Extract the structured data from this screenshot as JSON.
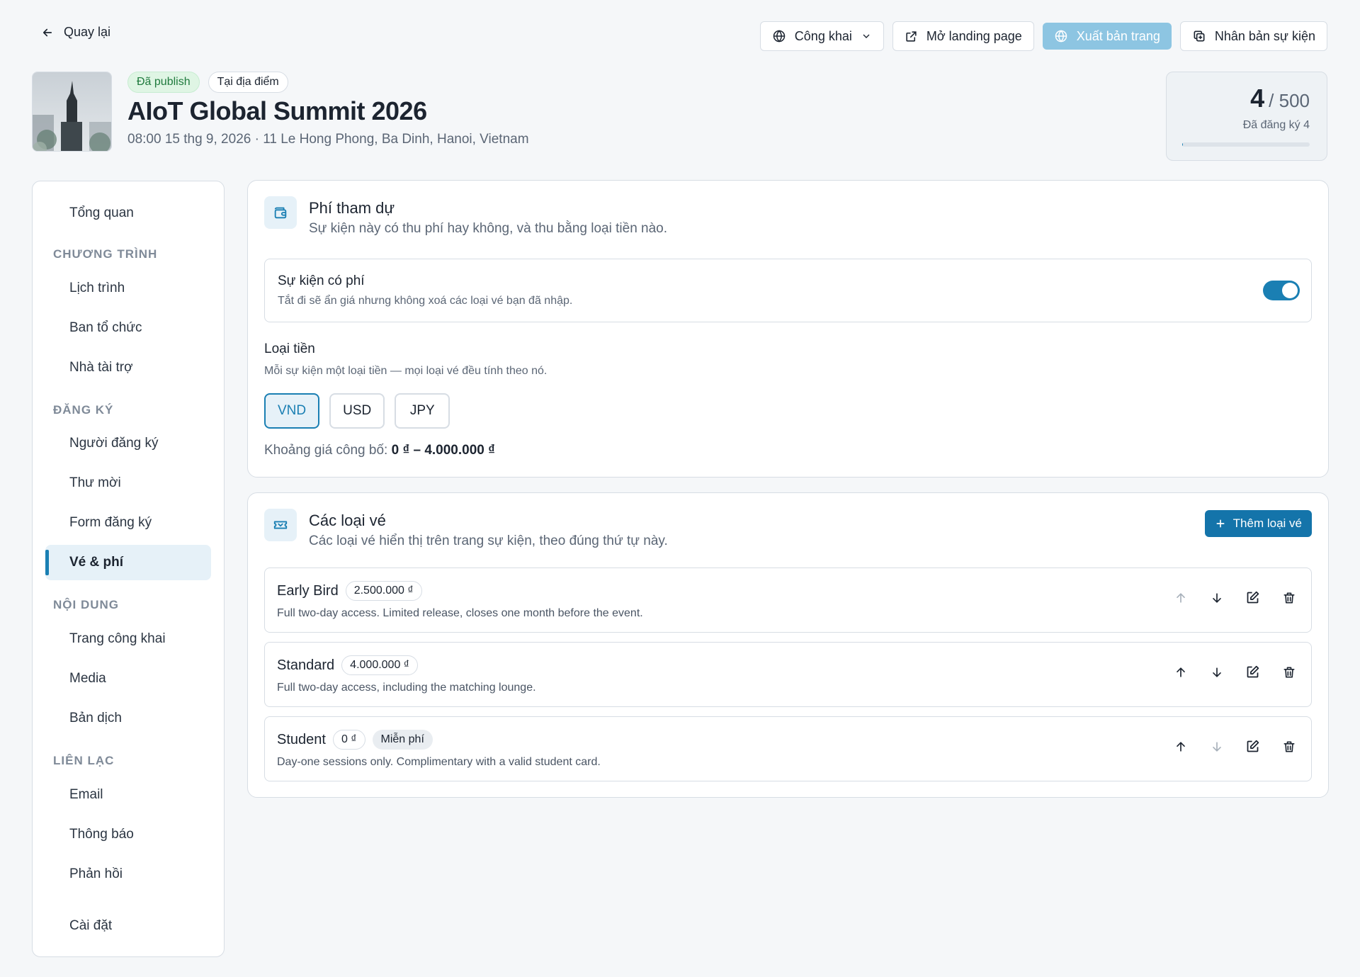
{
  "colors": {
    "accent": "#1a7fb3",
    "accent_light": "#e6f1f8",
    "success": "#1f7a3d",
    "primary_disabled": "#8dc5e2"
  },
  "topbar": {
    "back_label": "Quay lại",
    "visibility_label": "Công khai",
    "open_landing_label": "Mở landing page",
    "publish_label": "Xuất bản trang",
    "duplicate_label": "Nhân bản sự kiện"
  },
  "event": {
    "status_badge": "Đã publish",
    "location_type_badge": "Tại địa điểm",
    "title": "AIoT Global Summit 2026",
    "meta": "08:00 15 thg 9, 2026 · 11 Le Hong Phong, Ba Dinh, Hanoi, Vietnam"
  },
  "registration": {
    "count": "4",
    "capacity": "/ 500",
    "subtitle": "Đã đăng ký 4",
    "progress_fraction": 0.008
  },
  "sidebar": {
    "overview": "Tổng quan",
    "section_program": "CHƯƠNG TRÌNH",
    "schedule": "Lịch trình",
    "organizers": "Ban tổ chức",
    "sponsors": "Nhà tài trợ",
    "section_registration": "ĐĂNG KÝ",
    "registrants": "Người đăng ký",
    "invitations": "Thư mời",
    "registration_form": "Form đăng ký",
    "tickets_fees": "Vé & phí",
    "section_content": "NỘI DUNG",
    "public_page": "Trang công khai",
    "media": "Media",
    "translations": "Bản dịch",
    "section_contact": "LIÊN LẠC",
    "email": "Email",
    "notifications": "Thông báo",
    "feedback": "Phản hồi",
    "settings": "Cài đặt"
  },
  "fee_card": {
    "title": "Phí tham dự",
    "description": "Sự kiện này có thu phí hay không, và thu bằng loại tiền nào.",
    "paid_toggle_label": "Sự kiện có phí",
    "paid_toggle_help": "Tắt đi sẽ ẩn giá nhưng không xoá các loại vé bạn đã nhập.",
    "paid_toggle_on": true,
    "currency_heading": "Loại tiền",
    "currency_help": "Mỗi sự kiện một loại tiền — mọi loại vé đều tính theo nó.",
    "currencies": [
      "VND",
      "USD",
      "JPY"
    ],
    "selected_currency": "VND",
    "price_range_label": "Khoảng giá công bố:",
    "price_range_value": "0 ₫ – 4.000.000 ₫"
  },
  "tickets_card": {
    "title": "Các loại vé",
    "description": "Các loại vé hiển thị trên trang sự kiện, theo đúng thứ tự này.",
    "add_label": "Thêm loại vé",
    "tickets": [
      {
        "name": "Early Bird",
        "price": "2.500.000 ₫",
        "description": "Full two-day access. Limited release, closes one month before the event."
      },
      {
        "name": "Standard",
        "price": "4.000.000 ₫",
        "description": "Full two-day access, including the matching lounge."
      },
      {
        "name": "Student",
        "price": "0 ₫",
        "free_badge": "Miễn phí",
        "description": "Day-one sessions only. Complimentary with a valid student card."
      }
    ]
  }
}
